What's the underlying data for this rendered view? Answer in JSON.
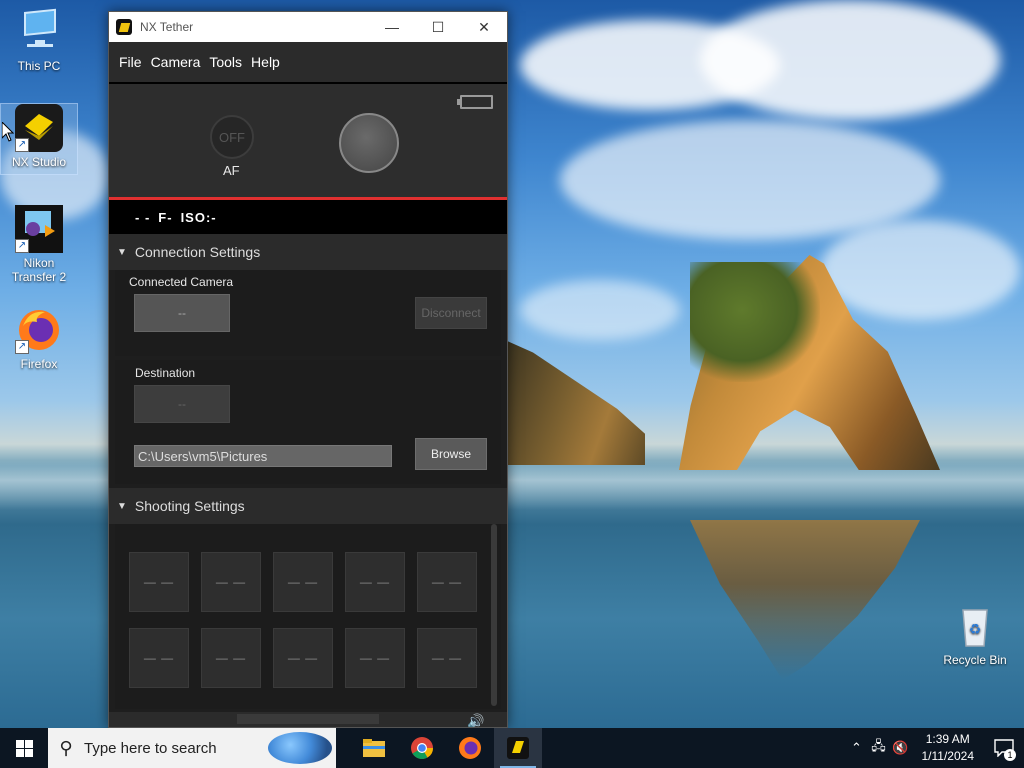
{
  "desktop": {
    "icons": [
      {
        "label": "This PC"
      },
      {
        "label": "NX Studio"
      },
      {
        "label": "Nikon Transfer 2",
        "brand": "Nikon"
      },
      {
        "label": "Firefox"
      },
      {
        "label": "Recycle Bin"
      }
    ]
  },
  "window": {
    "title": "NX Tether",
    "controls": {
      "minimize": "—",
      "maximize": "☐",
      "close": "✕"
    }
  },
  "menu": [
    "File",
    "Camera",
    "Tools",
    "Help"
  ],
  "camera": {
    "af_state": "OFF",
    "af_label": "AF",
    "exposure": {
      "shutter": "- -",
      "aperture": "F-",
      "iso": "ISO:-"
    }
  },
  "connection_settings": {
    "header": "Connection Settings",
    "connected_camera_label": "Connected Camera",
    "connected_camera_value": "--",
    "disconnect_label": "Disconnect",
    "destination_label": "Destination",
    "destination_value": "--",
    "destination_path": "C:\\Users\\vm5\\Pictures",
    "browse_label": "Browse"
  },
  "shooting_settings": {
    "header": "Shooting Settings",
    "tiles": [
      "— —",
      "— —",
      "— —",
      "— —",
      "— —",
      "— —",
      "— —",
      "— —",
      "— —",
      "— —"
    ]
  },
  "taskbar": {
    "search_placeholder": "Type here to search",
    "time": "1:39 AM",
    "date": "1/11/2024",
    "notification_count": "1"
  },
  "colors": {
    "accent_red": "#e03030",
    "window_bg": "#1e1e1e",
    "taskbar_bg": "#0c1622"
  }
}
